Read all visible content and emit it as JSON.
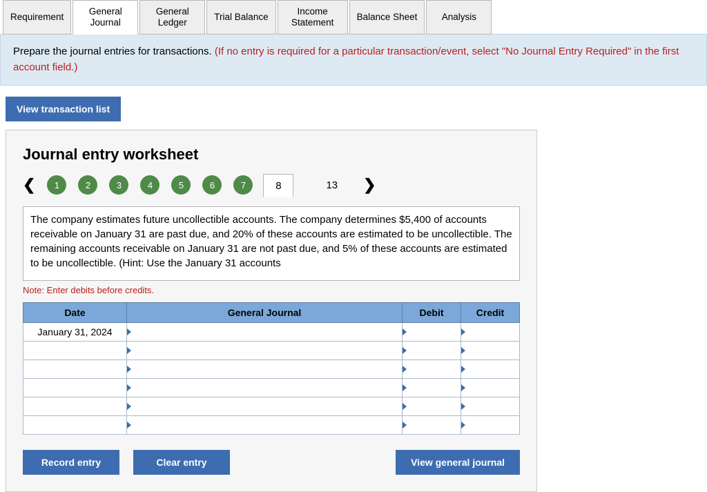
{
  "tabs": {
    "items": [
      {
        "label": "Requirement",
        "active": false
      },
      {
        "label": "General Journal",
        "active": true
      },
      {
        "label": "General Ledger",
        "active": false
      },
      {
        "label": "Trial Balance",
        "active": false
      },
      {
        "label": "Income Statement",
        "active": false
      },
      {
        "label": "Balance Sheet",
        "active": false
      },
      {
        "label": "Analysis",
        "active": false
      }
    ]
  },
  "instruction": {
    "black": "Prepare the journal entries for transactions. ",
    "red": "(If no entry is required for a particular transaction/event, select \"No Journal Entry Required\" in the first account field.)"
  },
  "buttons": {
    "view_list": "View transaction list",
    "record": "Record entry",
    "clear": "Clear entry",
    "view_gj": "View general journal"
  },
  "worksheet": {
    "title": "Journal entry worksheet",
    "stepper": {
      "done": [
        "1",
        "2",
        "3",
        "4",
        "5",
        "6",
        "7"
      ],
      "current": "8",
      "total": "13"
    },
    "description": "The company estimates future uncollectible accounts. The company determines $5,400 of accounts receivable on January 31 are past due, and 20% of these accounts are estimated to be uncollectible. The remaining accounts receivable on January 31 are not past due, and 5% of these accounts are estimated to be uncollectible. (Hint: Use the January 31 accounts",
    "note": "Note: Enter debits before credits.",
    "table": {
      "headers": {
        "date": "Date",
        "gj": "General Journal",
        "debit": "Debit",
        "credit": "Credit"
      },
      "rows": [
        {
          "date": "January 31, 2024",
          "gj": "",
          "debit": "",
          "credit": ""
        },
        {
          "date": "",
          "gj": "",
          "debit": "",
          "credit": ""
        },
        {
          "date": "",
          "gj": "",
          "debit": "",
          "credit": ""
        },
        {
          "date": "",
          "gj": "",
          "debit": "",
          "credit": ""
        },
        {
          "date": "",
          "gj": "",
          "debit": "",
          "credit": ""
        },
        {
          "date": "",
          "gj": "",
          "debit": "",
          "credit": ""
        }
      ]
    }
  }
}
